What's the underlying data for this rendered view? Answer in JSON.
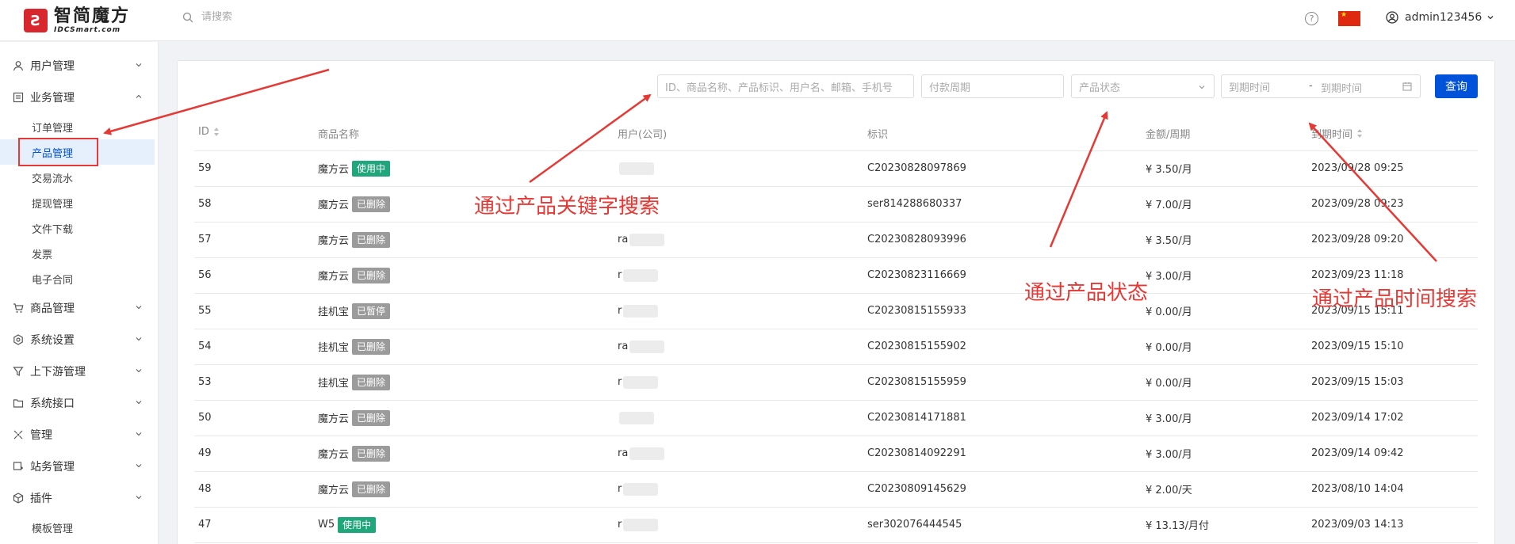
{
  "header": {
    "logo_name": "智简魔方",
    "logo_sub": "IDCSmart.com",
    "search_placeholder": "请搜索",
    "username": "admin123456"
  },
  "sidebar": {
    "items": [
      {
        "label": "用户管理",
        "icon": "user-icon",
        "expanded": false
      },
      {
        "label": "业务管理",
        "icon": "document-icon",
        "expanded": true
      },
      {
        "label": "商品管理",
        "icon": "cart-icon",
        "expanded": false
      },
      {
        "label": "系统设置",
        "icon": "gear-icon",
        "expanded": false
      },
      {
        "label": "上下游管理",
        "icon": "filter-icon",
        "expanded": false
      },
      {
        "label": "系统接口",
        "icon": "folder-icon",
        "expanded": false
      },
      {
        "label": "管理",
        "icon": "grid-icon",
        "expanded": false
      },
      {
        "label": "站务管理",
        "icon": "station-icon",
        "expanded": false
      },
      {
        "label": "插件",
        "icon": "plugin-icon",
        "expanded": false
      }
    ],
    "sub_items": [
      {
        "label": "订单管理",
        "active": false
      },
      {
        "label": "产品管理",
        "active": true
      },
      {
        "label": "交易流水",
        "active": false
      },
      {
        "label": "提现管理",
        "active": false
      },
      {
        "label": "文件下载",
        "active": false
      },
      {
        "label": "发票",
        "active": false
      },
      {
        "label": "电子合同",
        "active": false
      }
    ],
    "extra_item": "模板管理"
  },
  "filters": {
    "keyword_placeholder": "ID、商品名称、产品标识、用户名、邮箱、手机号",
    "period_placeholder": "付款周期",
    "status_placeholder": "产品状态",
    "date_start_placeholder": "到期时间",
    "date_end_placeholder": "到期时间",
    "query_label": "查询"
  },
  "table": {
    "headers": [
      "ID",
      "商品名称",
      "用户(公司)",
      "标识",
      "金额/周期",
      "到期时间"
    ],
    "rows": [
      {
        "id": "59",
        "product": "魔方云",
        "status": "使用中",
        "status_type": "green",
        "user": "",
        "tag": "C20230828097869",
        "amount": "¥ 3.50/月",
        "expire": "2023/09/28 09:25"
      },
      {
        "id": "58",
        "product": "魔方云",
        "status": "已删除",
        "status_type": "gray",
        "user": "",
        "tag": "ser814288680337",
        "amount": "¥ 7.00/月",
        "expire": "2023/09/28 09:23"
      },
      {
        "id": "57",
        "product": "魔方云",
        "status": "已删除",
        "status_type": "gray",
        "user": "ra",
        "tag": "C20230828093996",
        "amount": "¥ 3.50/月",
        "expire": "2023/09/28 09:20"
      },
      {
        "id": "56",
        "product": "魔方云",
        "status": "已删除",
        "status_type": "gray",
        "user": "r",
        "tag": "C20230823116669",
        "amount": "¥ 3.00/月",
        "expire": "2023/09/23 11:18"
      },
      {
        "id": "55",
        "product": "挂机宝",
        "status": "已暂停",
        "status_type": "gray",
        "user": "r",
        "tag": "C20230815155933",
        "amount": "¥ 0.00/月",
        "expire": "2023/09/15 15:11"
      },
      {
        "id": "54",
        "product": "挂机宝",
        "status": "已删除",
        "status_type": "gray",
        "user": "ra",
        "tag": "C20230815155902",
        "amount": "¥ 0.00/月",
        "expire": "2023/09/15 15:10"
      },
      {
        "id": "53",
        "product": "挂机宝",
        "status": "已删除",
        "status_type": "gray",
        "user": "r",
        "tag": "C20230815155959",
        "amount": "¥ 0.00/月",
        "expire": "2023/09/15 15:03"
      },
      {
        "id": "50",
        "product": "魔方云",
        "status": "已删除",
        "status_type": "gray",
        "user": "",
        "tag": "C20230814171881",
        "amount": "¥ 3.00/月",
        "expire": "2023/09/14 17:02"
      },
      {
        "id": "49",
        "product": "魔方云",
        "status": "已删除",
        "status_type": "gray",
        "user": "ra",
        "tag": "C20230814092291",
        "amount": "¥ 3.00/月",
        "expire": "2023/09/14 09:42"
      },
      {
        "id": "48",
        "product": "魔方云",
        "status": "已删除",
        "status_type": "gray",
        "user": "r",
        "tag": "C20230809145629",
        "amount": "¥ 2.00/天",
        "expire": "2023/08/10 14:04"
      },
      {
        "id": "47",
        "product": "W5",
        "status": "使用中",
        "status_type": "green",
        "user": "r",
        "tag": "ser302076444545",
        "amount": "¥ 13.13/月付",
        "expire": "2023/09/03 14:13"
      }
    ]
  },
  "annotations": {
    "keyword": "通过产品关键字搜索",
    "status": "通过产品状态",
    "time": "通过产品时间搜索"
  },
  "colors": {
    "primary": "#0052d9",
    "annotation": "#e53935",
    "badge_green": "#1fa67a",
    "badge_gray": "#9b9b9b"
  }
}
